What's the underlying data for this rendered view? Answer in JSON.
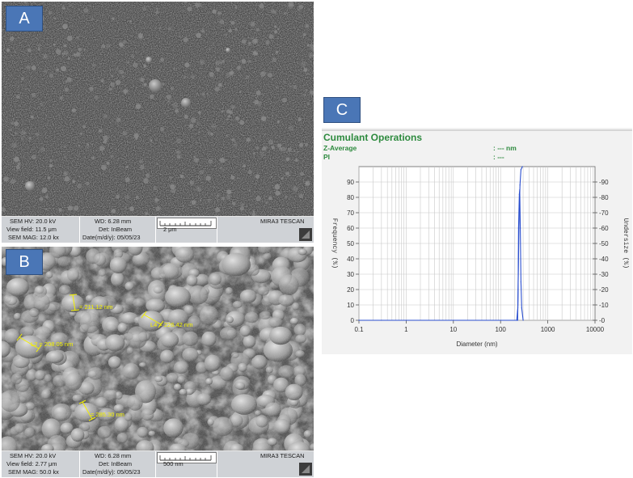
{
  "panel_a": {
    "label": "A",
    "info": {
      "hv": "SEM HV: 20.0 kV",
      "wd": "WD: 6.28 mm",
      "view_field": "View field: 11.5 μm",
      "det": "Det: InBeam",
      "scale": "2 μm",
      "mag": "SEM MAG: 12.0 kx",
      "date": "Date(m/d/y): 05/05/23",
      "brand": "MIRA3 TESCAN"
    }
  },
  "panel_b": {
    "label": "B",
    "info": {
      "hv": "SEM HV: 20.0 kV",
      "wd": "WD: 6.28 mm",
      "view_field": "View field: 2.77 μm",
      "det": "Det: InBeam",
      "scale": "500 nm",
      "mag": "SEM MAG: 50.0 kx",
      "date": "Date(m/d/y): 05/05/23",
      "brand": "MIRA3 TESCAN"
    },
    "measurements": [
      {
        "text": "= 211.12 nm"
      },
      {
        "text": "L4 = 226.42 nm"
      },
      {
        "text": "L2 = 208.05 nm"
      },
      {
        "text": "= 285.30 nm"
      }
    ]
  },
  "panel_c": {
    "label": "C",
    "title": "Cumulant Operations",
    "z_average_label": "Z-Average",
    "z_average_value": ": --- nm",
    "pi_label": "PI",
    "pi_value": ": ---",
    "chart_data": {
      "type": "line",
      "xlabel": "Diameter (nm)",
      "ylabel": "Frequency (%)",
      "y2label": "Undersize (%)",
      "xscale": "log",
      "xlim": [
        0.1,
        10000
      ],
      "ylim": [
        0,
        100
      ],
      "xticks": [
        "0.1",
        "1",
        "10",
        "100",
        "1000",
        "10000"
      ],
      "yticks": [
        "0",
        "10",
        "20",
        "30",
        "40",
        "50",
        "60",
        "70",
        "80",
        "90"
      ],
      "y2ticks": [
        "0",
        "10",
        "20",
        "30",
        "40",
        "50",
        "60",
        "70",
        "80",
        "90"
      ],
      "grid": true,
      "series": [
        {
          "x": [
            0.1,
            0.3,
            230,
            235,
            240,
            250,
            255,
            262,
            270,
            280,
            300
          ],
          "y": [
            0,
            0,
            0,
            20,
            60,
            82,
            85,
            60,
            25,
            8,
            0
          ],
          "color": "#2b4fcf"
        },
        {
          "x": [
            0.1,
            220,
            232,
            245,
            258,
            270,
            290
          ],
          "y": [
            0,
            0,
            8,
            60,
            88,
            98,
            100
          ],
          "color": "#2b4fcf"
        }
      ]
    }
  },
  "colors": {
    "label_bg": "#4a76b6",
    "title_green": "#2d8a3e",
    "measure_yellow": "#f3f000",
    "series_blue": "#2b4fcf"
  }
}
